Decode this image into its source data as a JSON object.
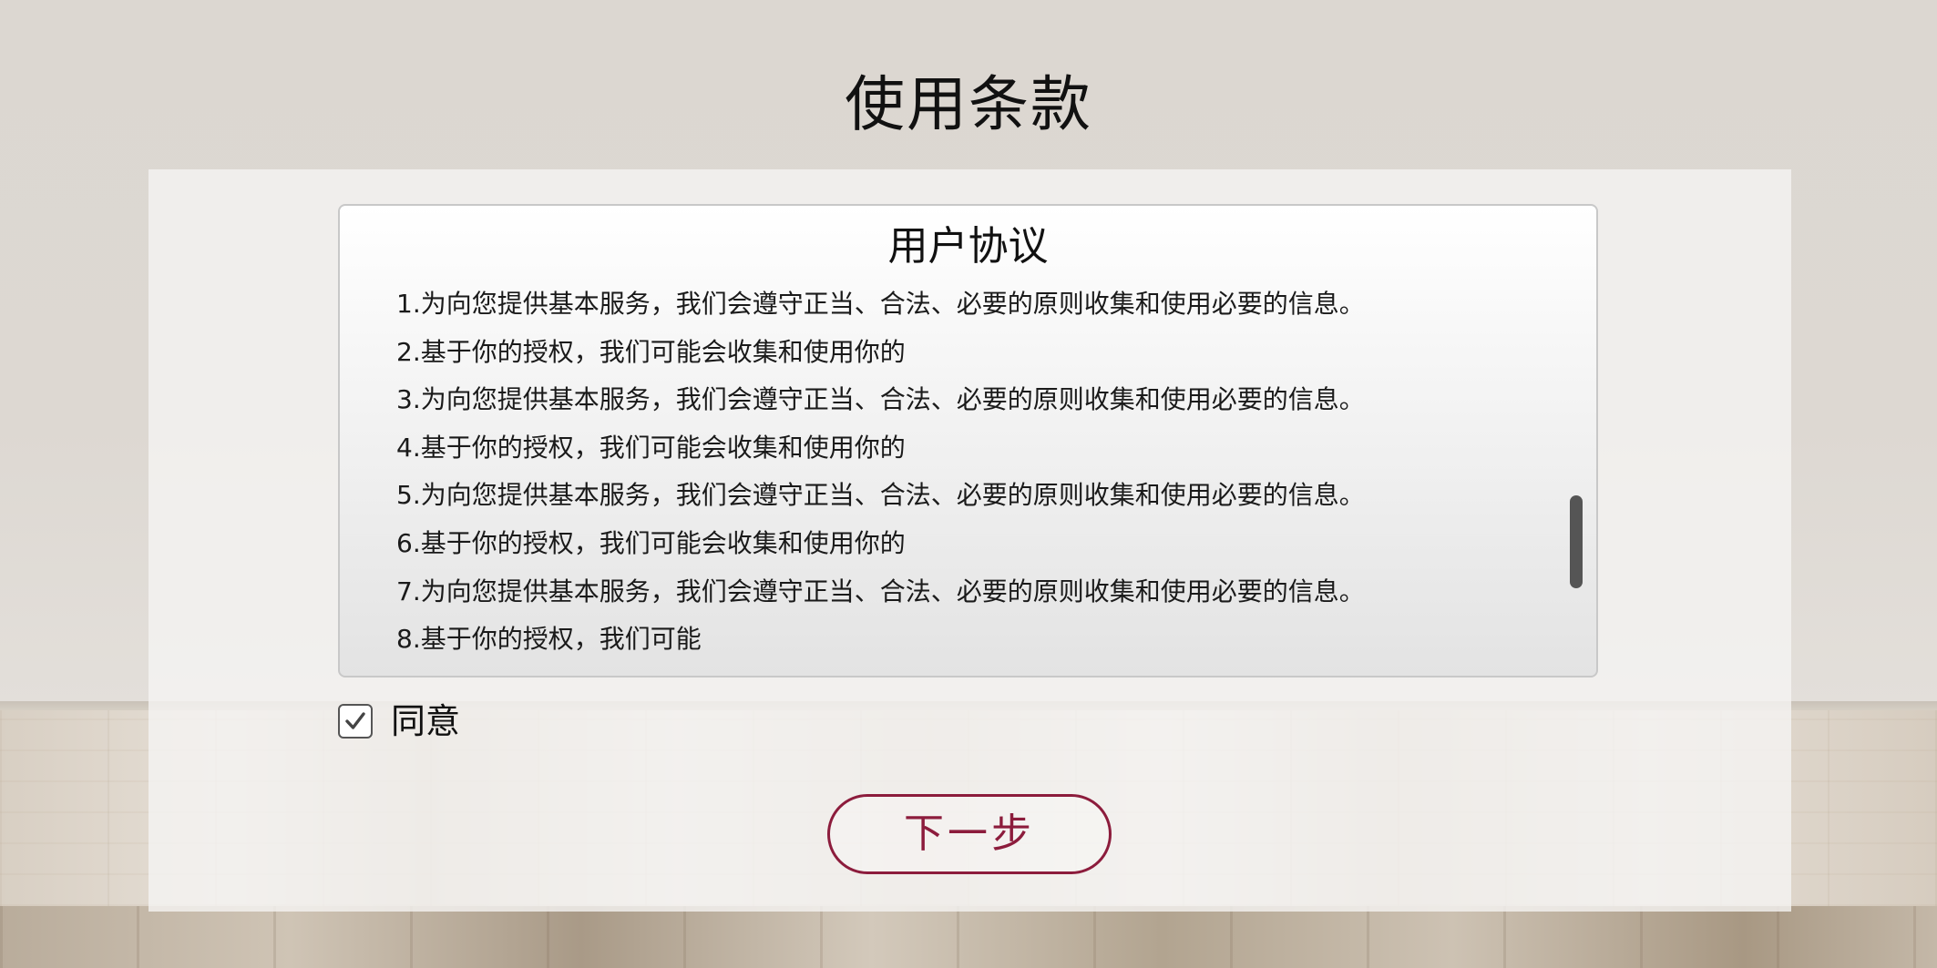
{
  "page": {
    "title": "使用条款"
  },
  "agreement": {
    "title": "用户协议",
    "terms": [
      "1.为向您提供基本服务，我们会遵守正当、合法、必要的原则收集和使用必要的信息。",
      "2.基于你的授权，我们可能会收集和使用你的",
      "3.为向您提供基本服务，我们会遵守正当、合法、必要的原则收集和使用必要的信息。",
      "4.基于你的授权，我们可能会收集和使用你的",
      "5.为向您提供基本服务，我们会遵守正当、合法、必要的原则收集和使用必要的信息。",
      "6.基于你的授权，我们可能会收集和使用你的",
      "7.为向您提供基本服务，我们会遵守正当、合法、必要的原则收集和使用必要的信息。",
      "8.基于你的授权，我们可能"
    ],
    "scroll_position": 0.62
  },
  "agree": {
    "label": "同意",
    "checked": true,
    "icon": "check-icon"
  },
  "next_button": {
    "label": "下一步"
  },
  "colors": {
    "accent": "#8c1c3c",
    "scrollbar": "#555555",
    "title_text": "#111111"
  }
}
